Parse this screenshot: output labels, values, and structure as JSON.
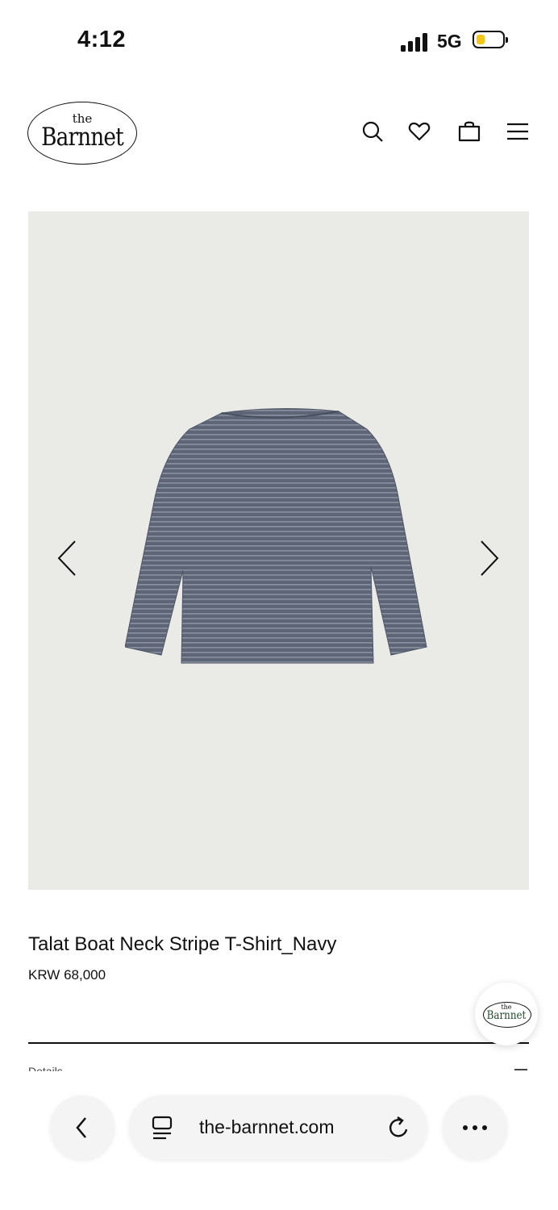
{
  "status_bar": {
    "time": "4:12",
    "network": "5G",
    "battery_color": "#f2c615"
  },
  "header": {
    "logo_small": "the",
    "logo_big": "Barnnet",
    "icons": [
      "search-icon",
      "heart-icon",
      "bag-icon",
      "menu-icon"
    ]
  },
  "gallery": {
    "image": "navy striped boat neck long sleeve t-shirt",
    "prev_icon": "chevron-left-icon",
    "next_icon": "chevron-right-icon"
  },
  "product": {
    "name": "Talat Boat Neck Stripe T-Shirt_Navy",
    "price": "KRW 68,000",
    "details_label": "Details"
  },
  "chat": {
    "logo_small": "the",
    "logo_big": "Barnnet"
  },
  "browser": {
    "url": "the-barnnet.com",
    "back_icon": "chevron-left-icon",
    "tabs_icon": "tab-overview-icon",
    "reload_icon": "reload-icon",
    "more_icon": "more-dots-icon"
  },
  "colors": {
    "accent": "#111111",
    "gallery_bg": "#eaeae7",
    "shirt": "#5d6577"
  }
}
